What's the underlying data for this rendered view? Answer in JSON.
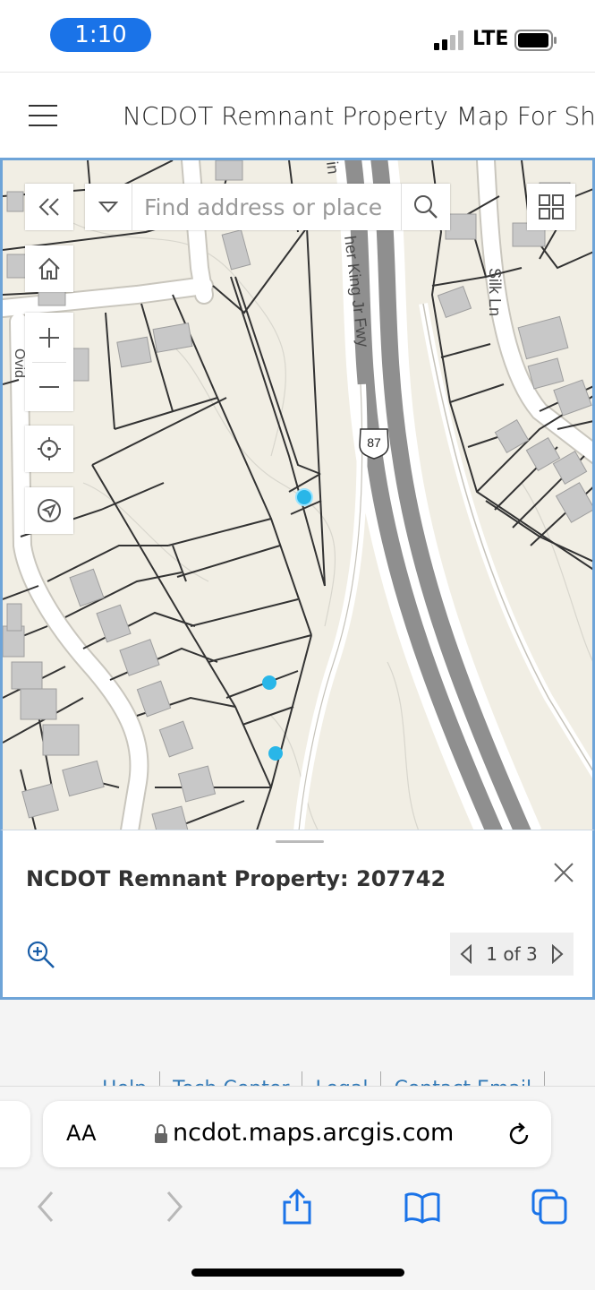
{
  "status_bar": {
    "time": "1:10",
    "network": "LTE"
  },
  "header": {
    "title": "NCDOT Remnant Property Map For Sh"
  },
  "map": {
    "search_placeholder": "Find address or place",
    "road_labels": {
      "freeway": "her King Jr Fwy",
      "freeway_prefix": "in",
      "route_shield": "87",
      "silk_ln": "Silk Ln",
      "left_road": "Ovid"
    },
    "colors": {
      "map_background": "#f1eee4",
      "frame_border": "#6ea4d8",
      "parcel_marker": "#29b6e8",
      "highway": "#8f8f8f"
    },
    "parcel_markers_count": 3
  },
  "popup": {
    "title": "NCDOT Remnant Property: 207742",
    "pager_text": "1 of 3"
  },
  "footer": {
    "links": [
      "Help",
      "Tech Center",
      "Legal",
      "Contact Email"
    ]
  },
  "safari": {
    "text_size_label": "AA",
    "url": "ncdot.maps.arcgis.com"
  }
}
